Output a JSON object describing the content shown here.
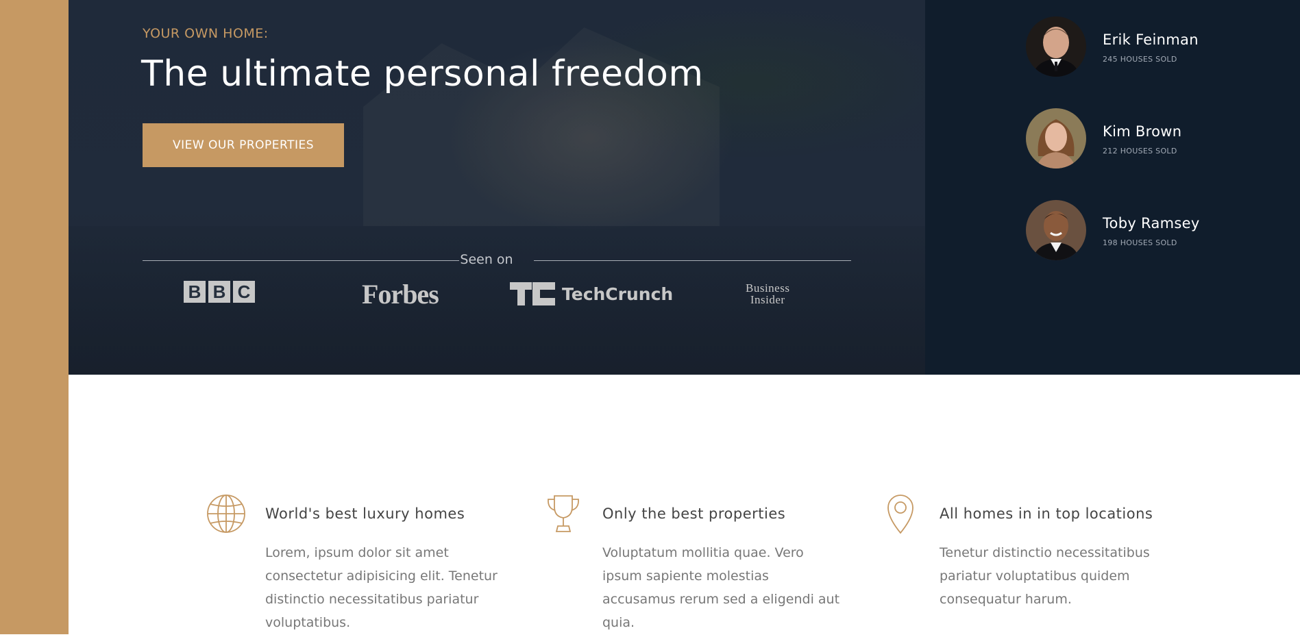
{
  "colors": {
    "accent": "#c69963",
    "hero_overlay": "#1f2a3a",
    "panel": "#101d2c"
  },
  "hero": {
    "subtitle": "YOUR OWN HOME:",
    "title": "The ultimate personal freedom",
    "cta_label": "VIEW OUR PROPERTIES",
    "seen_on_label": "Seen on",
    "logos": {
      "bbc_letters": [
        "B",
        "B",
        "C"
      ],
      "forbes": "Forbes",
      "techcrunch": "TechCrunch",
      "business_insider_line1": "Business",
      "business_insider_line2": "Insider"
    }
  },
  "agents": [
    {
      "name": "Erik Feinman",
      "sold": "245 HOUSES SOLD"
    },
    {
      "name": "Kim Brown",
      "sold": "212 HOUSES SOLD"
    },
    {
      "name": "Toby Ramsey",
      "sold": "198 HOUSES SOLD"
    }
  ],
  "features": [
    {
      "icon": "globe-icon",
      "title": "World's best luxury homes",
      "text": "Lorem, ipsum dolor sit amet consectetur adipisicing elit. Tenetur distinctio necessitatibus pariatur voluptatibus."
    },
    {
      "icon": "trophy-icon",
      "title": "Only the best properties",
      "text": "Voluptatum mollitia quae. Vero ipsum sapiente molestias accusamus rerum sed a eligendi aut quia."
    },
    {
      "icon": "map-pin-icon",
      "title": "All homes in in top locations",
      "text": "Tenetur distinctio necessitatibus pariatur voluptatibus quidem consequatur harum."
    }
  ]
}
